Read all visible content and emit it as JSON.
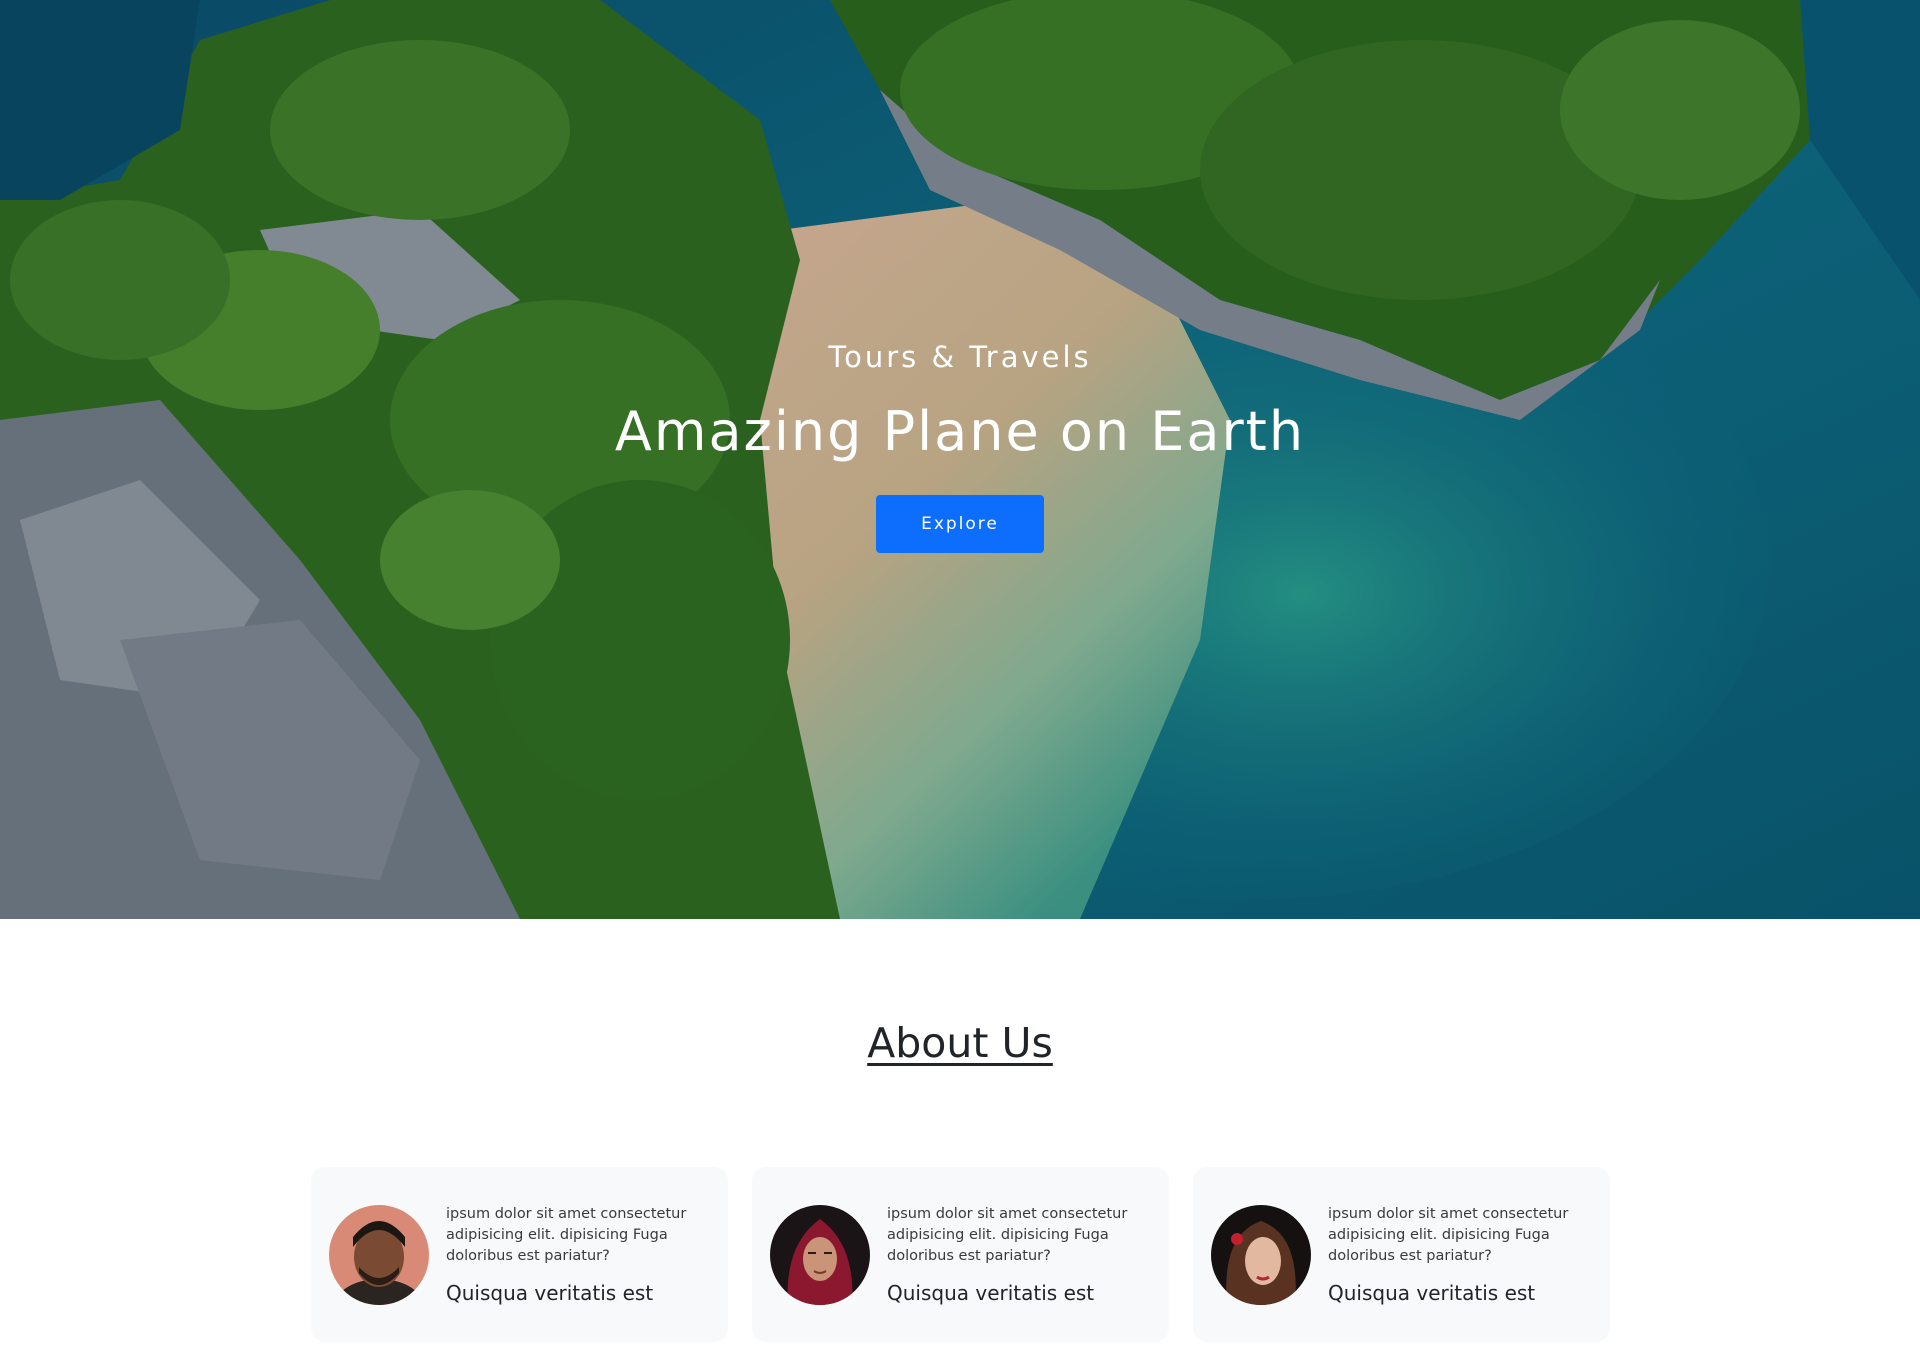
{
  "hero": {
    "subtitle": "Tours & Travels",
    "title": "Amazing Plane on Earth",
    "button_label": "Explore",
    "accent": "#0d6efd"
  },
  "about": {
    "title": "About Us",
    "cards": [
      {
        "avatar": "man-portrait-avatar",
        "text": "ipsum dolor sit amet consectetur adipisicing elit. dipisicing Fuga doloribus est pariatur?",
        "heading": "Quisqua veritatis est"
      },
      {
        "avatar": "woman-hijab-avatar",
        "text": "ipsum dolor sit amet consectetur adipisicing elit. dipisicing Fuga doloribus est pariatur?",
        "heading": "Quisqua veritatis est"
      },
      {
        "avatar": "woman-portrait-avatar",
        "text": "ipsum dolor sit amet consectetur adipisicing elit. dipisicing Fuga doloribus est pariatur?",
        "heading": "Quisqua veritatis est"
      }
    ]
  }
}
